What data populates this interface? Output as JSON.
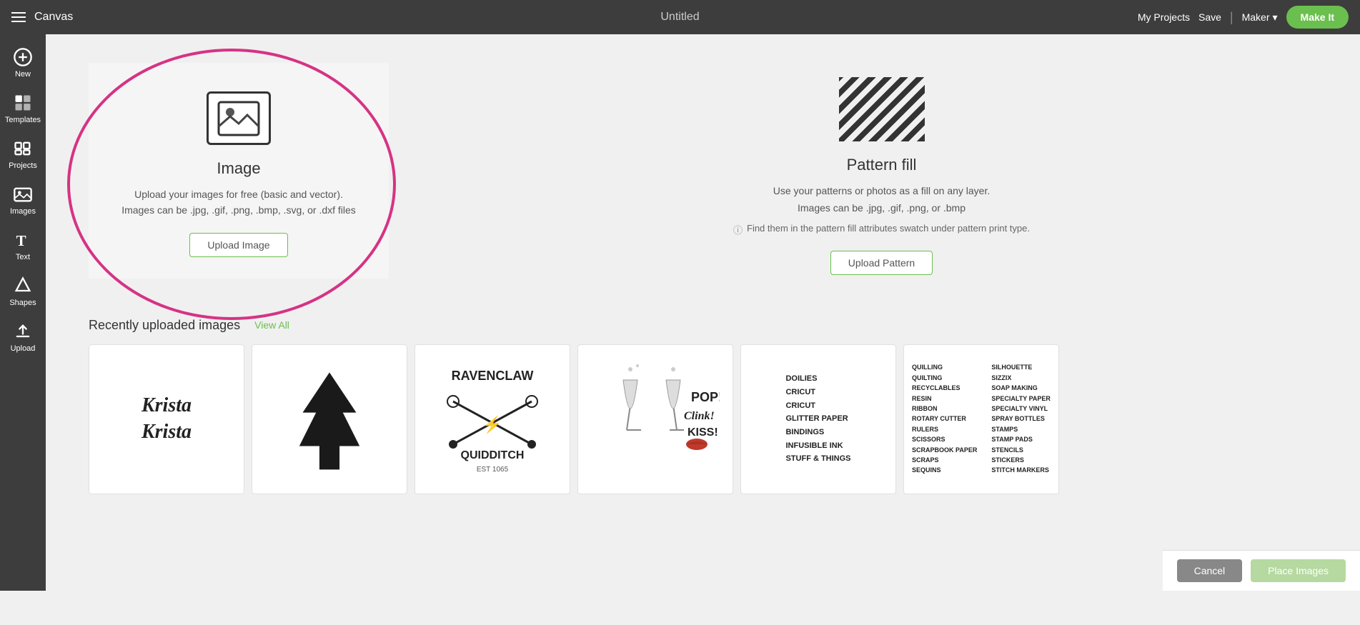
{
  "header": {
    "hamburger_label": "Menu",
    "title": "Canvas",
    "page_title": "Untitled",
    "my_projects": "My Projects",
    "save": "Save",
    "maker": "Maker",
    "make_it": "Make It"
  },
  "sidebar": {
    "items": [
      {
        "label": "New",
        "icon": "plus-circle-icon"
      },
      {
        "label": "Templates",
        "icon": "templates-icon"
      },
      {
        "label": "Projects",
        "icon": "projects-icon"
      },
      {
        "label": "Images",
        "icon": "images-icon"
      },
      {
        "label": "Text",
        "icon": "text-icon"
      },
      {
        "label": "Shapes",
        "icon": "shapes-icon"
      },
      {
        "label": "Upload",
        "icon": "upload-icon"
      }
    ]
  },
  "image_section": {
    "title": "Image",
    "desc_line1": "Upload your images for free (basic and vector).",
    "desc_line2": "Images can be .jpg, .gif, .png, .bmp, .svg, or .dxf files",
    "upload_btn": "Upload Image"
  },
  "pattern_section": {
    "title": "Pattern fill",
    "desc_line1": "Use your patterns or photos as a fill on any layer.",
    "desc_line2": "Images can be .jpg, .gif, .png, or .bmp",
    "info_text": "Find them in the pattern fill attributes swatch under pattern print type.",
    "upload_btn": "Upload Pattern"
  },
  "recently": {
    "title": "Recently uploaded images",
    "view_all": "View All"
  },
  "bottom_bar": {
    "cancel": "Cancel",
    "place": "Place Images"
  }
}
